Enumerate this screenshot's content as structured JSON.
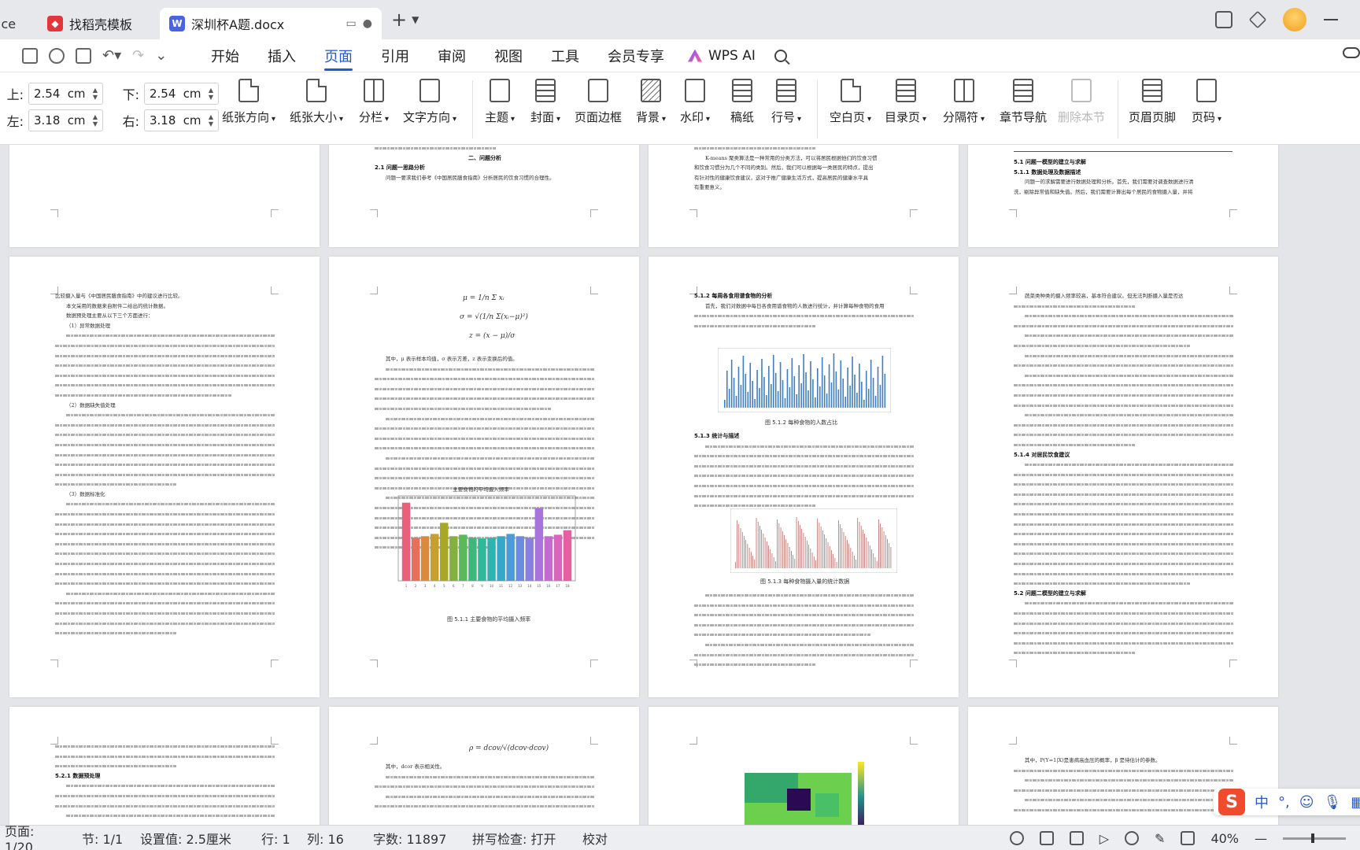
{
  "tabs": {
    "app_label": "ffice",
    "template_label": "找稻壳模板",
    "doc_label": "深圳杯A题.docx",
    "new_tab_symbol": "+"
  },
  "menu": {
    "items": [
      "开始",
      "插入",
      "页面",
      "引用",
      "审阅",
      "视图",
      "工具",
      "会员专享"
    ],
    "active_index": 2,
    "wps_ai": "WPS AI"
  },
  "ribbon": {
    "margin_top_label": "上:",
    "margin_top_value": "2.54",
    "margin_bottom_label": "下:",
    "margin_bottom_value": "2.54",
    "margin_left_label": "左:",
    "margin_left_value": "3.18",
    "margin_right_label": "右:",
    "margin_right_value": "3.18",
    "unit": "cm",
    "buttons": {
      "orientation": "纸张方向",
      "size": "纸张大小",
      "columns": "分栏",
      "text_direction": "文字方向",
      "theme": "主题",
      "cover": "封面",
      "border": "页面边框",
      "background": "背景",
      "watermark": "水印",
      "manuscript": "稿纸",
      "line_number": "行号",
      "blank_page": "空白页",
      "toc_page": "目录页",
      "separator": "分隔符",
      "chapter_nav": "章节导航",
      "delete_section": "删除本节",
      "header_footer": "页眉页脚",
      "page_number": "页码"
    }
  },
  "document": {
    "p2_heading": "二、问题分析",
    "p2_sub": "2.1 问题一思路分析",
    "p2_line": "问题一要求我们参考《中国居民膳食指南》分析居民的饮食习惯的合理性。",
    "p3_line1": "K-means 聚类算法是一种常用的分类方法，可以将居民根据他们的饮食习惯",
    "p3_line2": "和饮食习惯分为几个不同的类别。然后，我们可以根据每一类居民的特点，提出",
    "p3_line3": "有针对性的健康饮食建议，这对于推广健康生活方式，提高居民的健康水平具",
    "p3_line4": "有重要意义。",
    "p4_h1": "5.1 问题一模型的建立与求解",
    "p4_h2": "5.1.1 数据处理及数据描述",
    "p4_line1": "问题一的求解需要进行数据处理和分析。首先，我们需要对调查数据进行清",
    "p4_line2": "洗，剔除异常值和缺失值。然后，我们需要计算出每个居民的食物摄入量，并将",
    "p5_line1": "比较摄入量与《中国居民膳食指南》中的建议进行比较。",
    "p5_line2": "本文采用的数据来自附件二给出的统计数据。",
    "p5_line3": "数据预处理主要从以下三个方面进行：",
    "p5_line4": "（1）异常数据处理",
    "p5_line5": "（2）数据缺失值处理",
    "p5_line6": "（3）数据标准化",
    "p6_text1": "其中，μ 表示样本均值，σ 表示方差，z 表示变换后的值。",
    "p6_chart_title": "主要食物的平均摄入频率",
    "p6_caption": "图 5.1.1 主要食物的平均摄入频率",
    "p7_h1": "5.1.2 每周各食用谱食物的分析",
    "p7_line1": "首先，我们对数据中每日各食用谱食物的人数进行统计，并计算每种食物的食用",
    "p7_caption1": "图 5.1.2 每种食物的人数占比",
    "p7_h2": "5.1.3 统计与描述",
    "p7_caption2": "图 5.1.3 每种食物摄入量的统计数据",
    "p8_line1": "蔬菜类种类的摄入频率较高，基本符合建议。但无法判断摄入量是否达",
    "p8_h1": "5.1.4 对居民饮食建议",
    "p8_h2": "5.2 问题二模型的建立与求解",
    "p9_h": "5.2.1 数据预处理",
    "p10_text": "其中，dcor 表示相关性。",
    "p12_text": "其中，P(Y=1|X)是患病高血压的概率，β 是待估计的参数。"
  },
  "chart_data": {
    "type": "bar",
    "title": "主要食物的平均摄入频率",
    "categories": [
      "1",
      "2",
      "3",
      "4",
      "5",
      "6",
      "7",
      "8",
      "9",
      "10",
      "11",
      "12",
      "13",
      "14",
      "15",
      "16",
      "17",
      "18"
    ],
    "values": [
      2.05,
      1.58,
      1.6,
      1.63,
      1.78,
      1.6,
      1.62,
      1.58,
      1.57,
      1.58,
      1.6,
      1.63,
      1.6,
      1.58,
      1.98,
      1.6,
      1.62,
      1.68
    ],
    "ylim": [
      1.0,
      2.1
    ],
    "colors": [
      "#e8607a",
      "#e8705a",
      "#d98a3c",
      "#c7a02c",
      "#a8a826",
      "#84b03c",
      "#5cb85c",
      "#3db87a",
      "#2fb89a",
      "#2eb3b3",
      "#35a8c8",
      "#4a9bd8",
      "#6a8de0",
      "#8a80e0",
      "#a874dc",
      "#c46ad0",
      "#d866bc",
      "#e65fa0"
    ]
  },
  "status": {
    "page": "页面: 1/20",
    "section": "节: 1/1",
    "setting": "设置值: 2.5厘米",
    "row": "行: 1",
    "col": "列: 16",
    "words": "字数: 11897",
    "spell": "拼写检查: 打开",
    "proof": "校对",
    "zoom": "40%"
  },
  "ime": {
    "mode": "中",
    "punct": "°,"
  }
}
